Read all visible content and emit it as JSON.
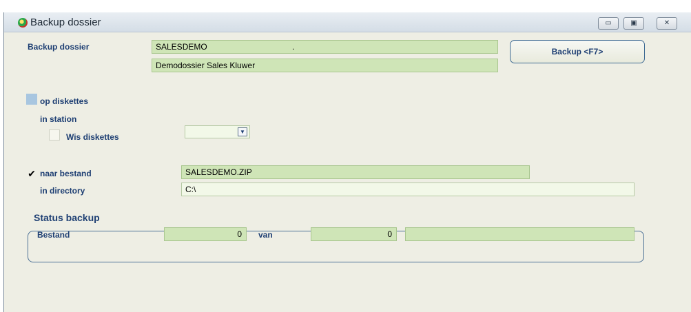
{
  "window": {
    "title": "Backup dossier"
  },
  "titlebar_buttons": {
    "minimize": "▭",
    "restore": "▣",
    "close": "✕"
  },
  "backup_dossier": {
    "label": "Backup dossier",
    "code": "SALESDEMO                                     .",
    "description": "Demodossier Sales Kluwer"
  },
  "backup_button": {
    "label": "Backup <F7>"
  },
  "diskettes": {
    "op_diskettes_label": "op diskettes",
    "in_station_label": "in station",
    "wis_diskettes_label": "Wis diskettes",
    "station_value": ""
  },
  "bestand": {
    "naar_bestand_label": "naar bestand",
    "naar_bestand_checked": "✔",
    "file_value": "SALESDEMO.ZIP",
    "in_directory_label": "in directory",
    "directory_value": "C:\\"
  },
  "status": {
    "title": "Status backup",
    "bestand_label": "Bestand",
    "current": "0",
    "van_label": "van",
    "total": "0",
    "progress_text": ""
  },
  "colors": {
    "window_bg": "#eeeee4",
    "field_green": "#cfe5b7",
    "label_blue": "#1e3f73"
  }
}
